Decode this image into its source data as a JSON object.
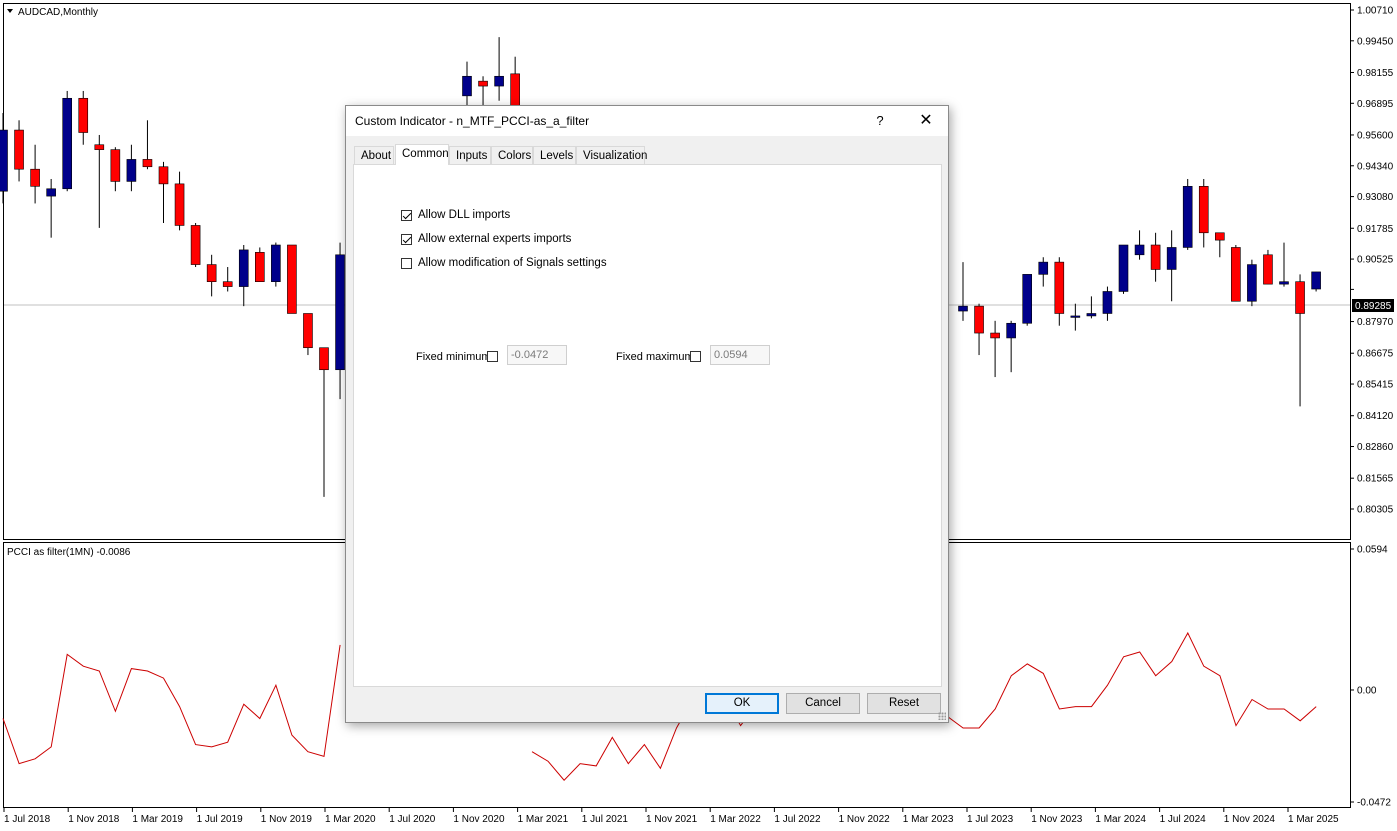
{
  "chart": {
    "symbol_label": "AUDCAD,Monthly",
    "indicator_label": "PCCI as filter(1MN) -0.0086",
    "price_axis": [
      "1.00710",
      "0.99450",
      "0.98155",
      "0.96895",
      "0.95600",
      "0.94340",
      "0.93080",
      "0.91785",
      "0.90525",
      "0.89285",
      "0.87970",
      "0.86675",
      "0.85415",
      "0.84120",
      "0.82860",
      "0.81565",
      "0.80305"
    ],
    "current_price": "0.89285",
    "indicator_axis": [
      "0.0594",
      "0.00",
      "-0.0472"
    ],
    "time_axis": [
      "1 Jul 2018",
      "1 Nov 2018",
      "1 Mar 2019",
      "1 Jul 2019",
      "1 Nov 2019",
      "1 Mar 2020",
      "1 Jul 2020",
      "1 Nov 2020",
      "1 Mar 2021",
      "1 Jul 2021",
      "1 Nov 2021",
      "1 Mar 2022",
      "1 Jul 2022",
      "1 Nov 2022",
      "1 Mar 2023",
      "1 Jul 2023",
      "1 Nov 2023",
      "1 Mar 2024",
      "1 Jul 2024",
      "1 Nov 2024",
      "1 Mar 2025"
    ],
    "colors": {
      "bull": "#00008b",
      "bear": "#ff0000",
      "indicator_line": "#cc0000",
      "price_line": "#c0c0c0"
    },
    "candles": [
      [
        0.933,
        0.965,
        0.928,
        0.958
      ],
      [
        0.958,
        0.962,
        0.937,
        0.942
      ],
      [
        0.942,
        0.952,
        0.928,
        0.935
      ],
      [
        0.931,
        0.938,
        0.914,
        0.934
      ],
      [
        0.934,
        0.974,
        0.933,
        0.971
      ],
      [
        0.971,
        0.974,
        0.952,
        0.957
      ],
      [
        0.952,
        0.956,
        0.918,
        0.95
      ],
      [
        0.95,
        0.951,
        0.933,
        0.937
      ],
      [
        0.937,
        0.952,
        0.933,
        0.946
      ],
      [
        0.946,
        0.962,
        0.942,
        0.943
      ],
      [
        0.943,
        0.945,
        0.92,
        0.936
      ],
      [
        0.936,
        0.941,
        0.917,
        0.919
      ],
      [
        0.919,
        0.92,
        0.902,
        0.903
      ],
      [
        0.903,
        0.907,
        0.89,
        0.896
      ],
      [
        0.896,
        0.902,
        0.892,
        0.894
      ],
      [
        0.894,
        0.911,
        0.886,
        0.909
      ],
      [
        0.908,
        0.91,
        0.896,
        0.896
      ],
      [
        0.896,
        0.912,
        0.894,
        0.911
      ],
      [
        0.911,
        0.911,
        0.884,
        0.883
      ],
      [
        0.883,
        0.883,
        0.866,
        0.869
      ],
      [
        0.869,
        0.869,
        0.808,
        0.86
      ],
      [
        0.86,
        0.912,
        0.848,
        0.907
      ]
    ],
    "candles_right": [
      [
        0.884,
        0.904,
        0.88,
        0.886
      ],
      [
        0.886,
        0.887,
        0.866,
        0.875
      ],
      [
        0.875,
        0.88,
        0.857,
        0.873
      ],
      [
        0.873,
        0.88,
        0.859,
        0.879
      ],
      [
        0.879,
        0.899,
        0.878,
        0.899
      ],
      [
        0.899,
        0.906,
        0.894,
        0.904
      ],
      [
        0.904,
        0.906,
        0.878,
        0.883
      ],
      [
        0.882,
        0.887,
        0.876,
        0.882
      ],
      [
        0.882,
        0.89,
        0.881,
        0.883
      ],
      [
        0.883,
        0.894,
        0.88,
        0.892
      ],
      [
        0.892,
        0.909,
        0.891,
        0.911
      ],
      [
        0.907,
        0.917,
        0.905,
        0.911
      ],
      [
        0.911,
        0.916,
        0.896,
        0.901
      ],
      [
        0.901,
        0.917,
        0.888,
        0.91
      ],
      [
        0.91,
        0.938,
        0.909,
        0.935
      ],
      [
        0.935,
        0.938,
        0.91,
        0.916
      ],
      [
        0.916,
        0.914,
        0.906,
        0.913
      ],
      [
        0.91,
        0.911,
        0.888,
        0.888
      ],
      [
        0.888,
        0.905,
        0.886,
        0.903
      ],
      [
        0.907,
        0.909,
        0.895,
        0.895
      ],
      [
        0.895,
        0.912,
        0.894,
        0.896
      ],
      [
        0.896,
        0.899,
        0.845,
        0.883
      ],
      [
        0.893,
        0.9,
        0.892,
        0.9
      ]
    ],
    "candles_top": [
      [
        0.972,
        0.986,
        0.962,
        0.98
      ],
      [
        0.978,
        0.98,
        0.962,
        0.976
      ],
      [
        0.976,
        0.996,
        0.97,
        0.98
      ],
      [
        0.981,
        0.988,
        0.962,
        0.968
      ]
    ],
    "indicator_left": [
      -0.012,
      -0.031,
      -0.029,
      -0.024,
      0.015,
      0.01,
      0.008,
      -0.009,
      0.009,
      0.008,
      0.005,
      -0.007,
      -0.023,
      -0.024,
      -0.022,
      -0.006,
      -0.012,
      0.002,
      -0.019,
      -0.026,
      -0.028,
      0.019
    ],
    "indicator_mid": [
      -0.026,
      -0.03,
      -0.038,
      -0.031,
      -0.032,
      -0.02,
      -0.031,
      -0.023,
      -0.033,
      -0.016,
      -0.004,
      -0.007,
      -0.003,
      -0.015,
      -0.006,
      -0.009
    ],
    "indicator_right": [
      -0.005,
      -0.011,
      -0.016,
      -0.016,
      -0.008,
      0.006,
      0.011,
      0.007,
      -0.008,
      -0.007,
      -0.007,
      0.002,
      0.014,
      0.016,
      0.006,
      0.012,
      0.024,
      0.01,
      0.006,
      -0.015,
      -0.004,
      -0.008,
      -0.008,
      -0.013,
      -0.007
    ]
  },
  "dialog": {
    "title": "Custom Indicator - n_MTF_PCCI-as_a_filter",
    "help_label": "?",
    "close_label": "✕",
    "tabs": [
      "About",
      "Common",
      "Inputs",
      "Colors",
      "Levels",
      "Visualization"
    ],
    "checkboxes": [
      {
        "label": "Allow DLL imports",
        "checked": true
      },
      {
        "label": "Allow external experts imports",
        "checked": true
      },
      {
        "label": "Allow modification of Signals settings",
        "checked": false
      }
    ],
    "fixed_minimum": {
      "label": "Fixed minimum",
      "value": "-0.0472"
    },
    "fixed_maximum": {
      "label": "Fixed maximum",
      "value": "0.0594"
    },
    "buttons": {
      "ok": "OK",
      "cancel": "Cancel",
      "reset": "Reset"
    }
  }
}
